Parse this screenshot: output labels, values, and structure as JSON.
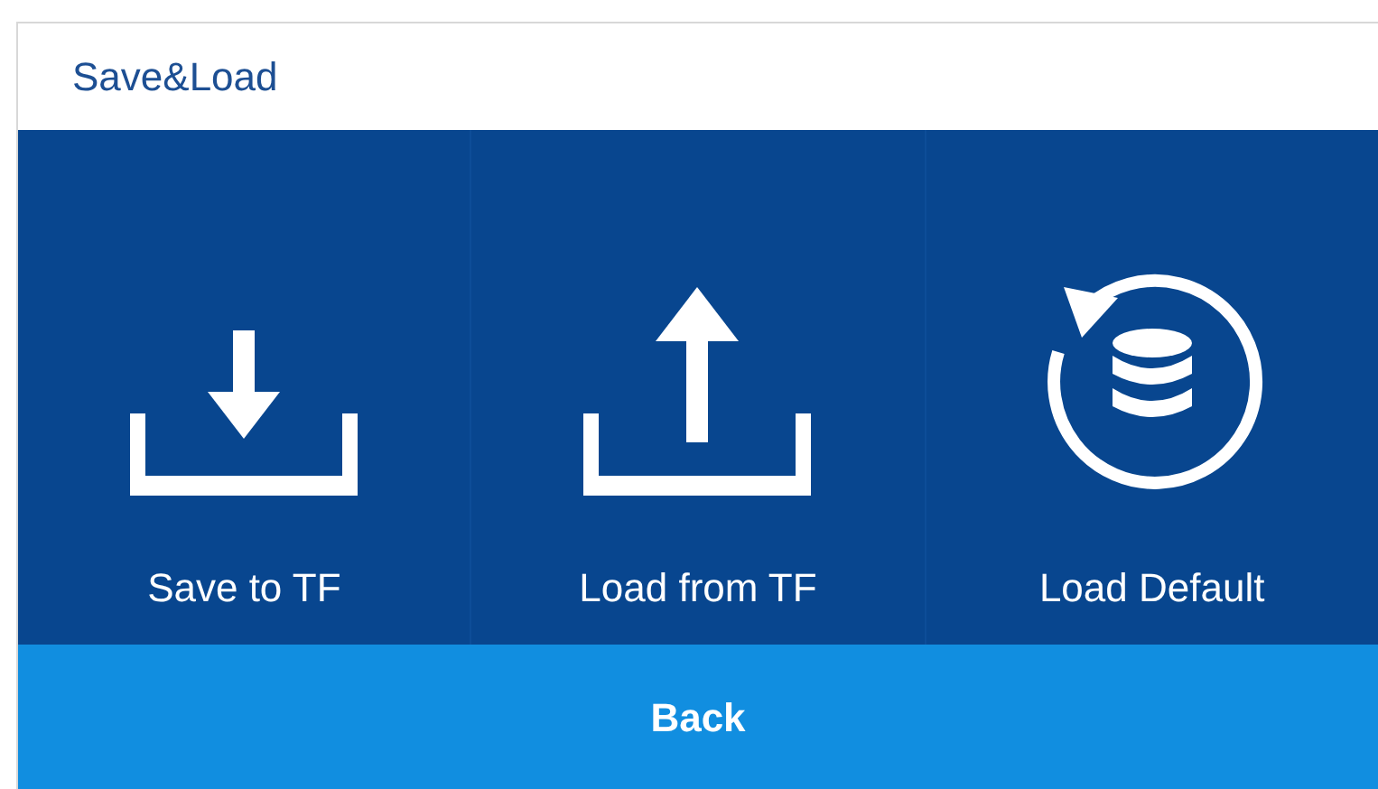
{
  "window": {
    "title": "Save&Load"
  },
  "actions": [
    {
      "kind": "save",
      "label": "Save to TF"
    },
    {
      "kind": "load",
      "label": "Load from TF"
    },
    {
      "kind": "default",
      "label": "Load Default"
    }
  ],
  "back_button": {
    "label": "Back"
  }
}
